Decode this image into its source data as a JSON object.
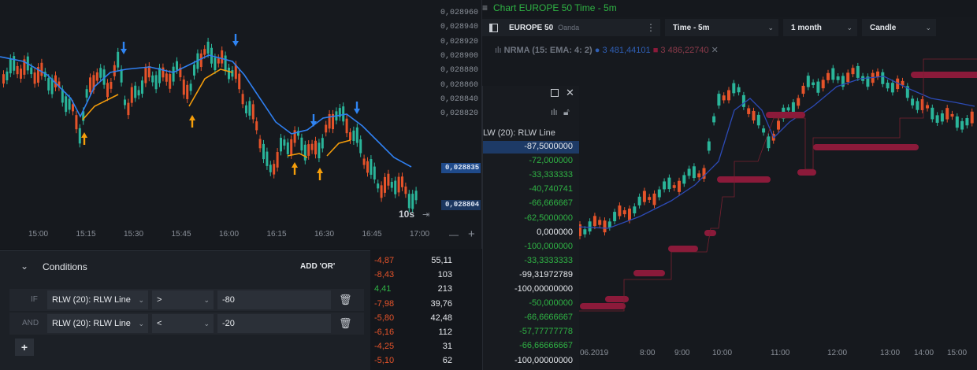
{
  "colors": {
    "up": "#2ab59a",
    "down": "#e5532a",
    "ma_blue": "#2f7ff0",
    "ma_orange": "#f29b0a",
    "arrow_blue": "#2f84f2",
    "arrow_orange": "#f59e0b",
    "band": "#8b1a3a",
    "green_text": "#2fb344",
    "red_text": "#e5532a"
  },
  "left_chart": {
    "price_ticks": [
      "0,028960",
      "0,028940",
      "0,028920",
      "0,028900",
      "0,028880",
      "0,028860",
      "0,028840",
      "0,028820"
    ],
    "time_ticks": [
      "15:00",
      "15:15",
      "15:30",
      "15:45",
      "16:00",
      "16:15",
      "16:30",
      "16:45",
      "17:00"
    ],
    "price_tag_high": "0,028835",
    "price_tag_low": "0,028804",
    "countdown": "10s",
    "zoom_out": "—",
    "zoom_in": "+"
  },
  "right_panel": {
    "title": "Chart EUROPE 50 Time - 5m",
    "symbol": "EUROPE 50",
    "broker": "Oanda",
    "timeframe": "Time - 5m",
    "range": "1 month",
    "chart_type": "Candle",
    "indicator": "NRMA (15: EMA: 4: 2)",
    "indicator_val1": "3 481,44101",
    "indicator_val2": "3 486,22740",
    "time_ticks": [
      "06.2019",
      "8:00",
      "9:00",
      "10:00",
      "11:00",
      "12:00",
      "13:00",
      "14:00",
      "15:00"
    ]
  },
  "table": {
    "header": "LW (20): RLW Line",
    "values": [
      "-87,5000000",
      "-72,000000",
      "-33,333333",
      "-40,740741",
      "-66,666667",
      "-62,5000000",
      "0,000000",
      "-100,000000",
      "-33,3333333",
      "-99,31972789",
      "-100,00000000",
      "-50,000000",
      "-66,6666667",
      "-57,77777778",
      "-66,66666667",
      "-100,00000000"
    ],
    "mid_pct": [
      "-4,87",
      "-8,43",
      "4,41",
      "-7,98",
      "-5,80",
      "-6,16",
      "-4,25",
      "-5,10"
    ],
    "mid_val": [
      "55,11",
      "103",
      "213",
      "39,76",
      "42,48",
      "112",
      "31",
      "62"
    ]
  },
  "conditions": {
    "title": "Conditions",
    "add_or": "ADD 'OR'",
    "rows": [
      {
        "prefix": "IF",
        "indicator": "RLW (20): RLW Line",
        "op": ">",
        "value": "-80"
      },
      {
        "prefix": "AND",
        "indicator": "RLW (20): RLW Line",
        "op": "<",
        "value": "-20"
      }
    ],
    "add_label": "+"
  }
}
